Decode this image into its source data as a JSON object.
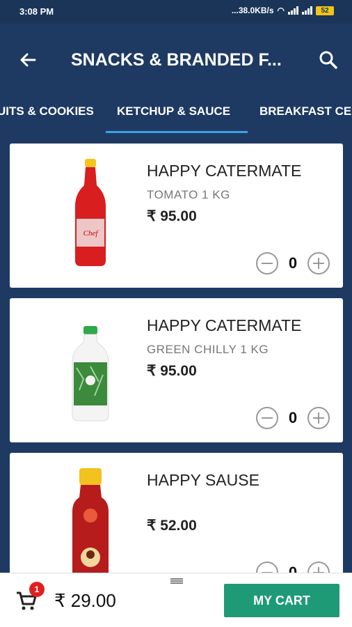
{
  "status_bar": {
    "time": "3:08 PM",
    "network_speed": "...38.0KB/s",
    "battery": "52"
  },
  "app_bar": {
    "title": "SNACKS & BRANDED F...",
    "back_icon": "arrow-left-icon",
    "search_icon": "search-icon"
  },
  "tabs": [
    {
      "label": "UITS & COOKIES",
      "selected": false
    },
    {
      "label": "KETCHUP & SAUCE",
      "selected": true
    },
    {
      "label": "BREAKFAST CE",
      "selected": false
    }
  ],
  "colors": {
    "primary": "#1e3a63",
    "tab_indicator": "#3da0e8",
    "cart_button": "#1f9a76",
    "badge": "#e02020"
  },
  "products": [
    {
      "brand": "HAPPY CATERMATE",
      "variant": "TOMATO 1 KG",
      "price": "₹ 95.00",
      "quantity": "0"
    },
    {
      "brand": "HAPPY CATERMATE",
      "variant": "GREEN CHILLY 1 KG",
      "price": "₹ 95.00",
      "quantity": "0"
    },
    {
      "brand": "HAPPY SAUSE",
      "variant": "",
      "price": "₹ 52.00",
      "quantity": "0"
    }
  ],
  "bottom_bar": {
    "cart_count": "1",
    "cart_total": "₹ 29.00",
    "cart_button_label": "MY CART"
  }
}
